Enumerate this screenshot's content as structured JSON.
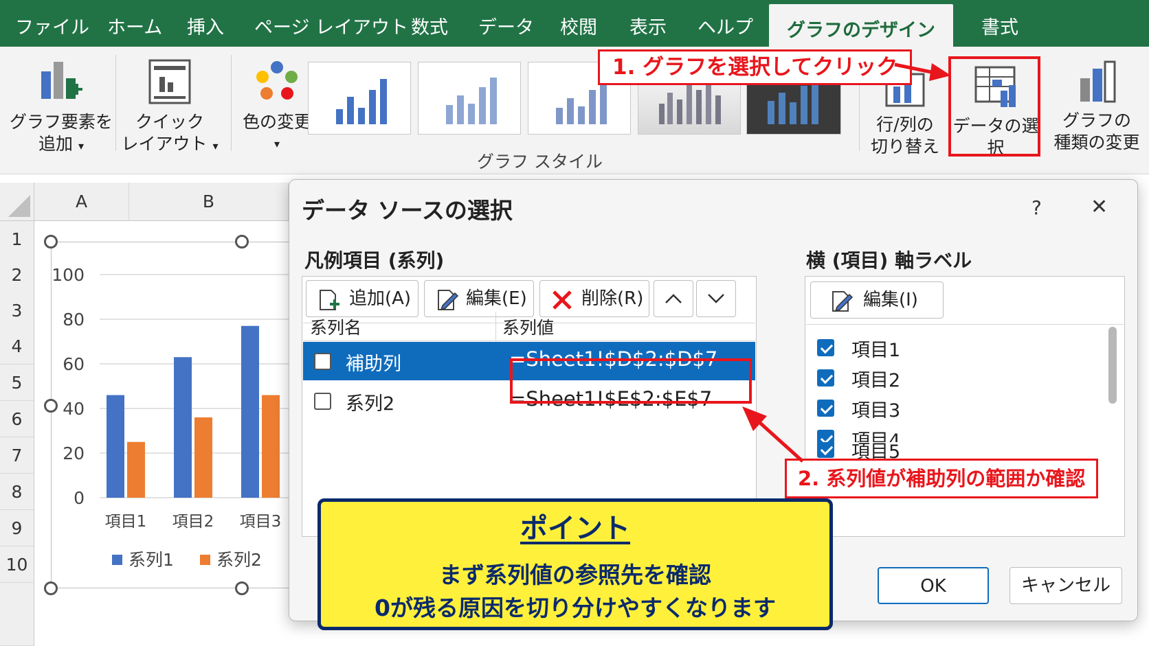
{
  "ribbon_tabs": [
    "ファイル",
    "ホーム",
    "挿入",
    "ページ レイアウト",
    "数式",
    "データ",
    "校閲",
    "表示",
    "ヘルプ",
    "グラフのデザイン",
    "書式"
  ],
  "ribbon": {
    "add_element_l1": "グラフ要素を",
    "add_element_l2": "追加",
    "quick_layout_l1": "クイック",
    "quick_layout_l2": "レイアウト",
    "change_color": "色の変更",
    "chart_styles": "グラフ スタイル",
    "switch_row_col_l1": "行/列の",
    "switch_row_col_l2": "切り替え",
    "select_data": "データの選択",
    "change_type_l1": "グラフの",
    "change_type_l2": "種類の変更"
  },
  "annotations": {
    "step1": "1. グラフを選択してクリック",
    "step2": "2. 系列値が補助列の範囲か確認",
    "point_title": "ポイント",
    "point_line1": "まず系列値の参照先を確認",
    "point_line2": "0が残る原因を切り分けやすくなります"
  },
  "sheet": {
    "columns": [
      "A",
      "B"
    ],
    "rows": [
      "1",
      "2",
      "3",
      "4",
      "5",
      "6",
      "7",
      "8",
      "9",
      "10"
    ]
  },
  "chart_data": {
    "type": "bar",
    "categories": [
      "項目1",
      "項目2",
      "項目3"
    ],
    "series": [
      {
        "name": "系列1",
        "values": [
          46,
          63,
          77
        ],
        "color": "#4472c4"
      },
      {
        "name": "系列2",
        "values": [
          25,
          36,
          46
        ],
        "color": "#ed7d31"
      }
    ],
    "ylim": [
      0,
      100
    ],
    "yticks": [
      "100",
      "80",
      "60",
      "40",
      "20",
      "0"
    ],
    "legend": "bottom",
    "grid": true
  },
  "dialog": {
    "title": "データ ソースの選択",
    "help": "?",
    "close": "✕",
    "legend_section": "凡例項目 (系列)",
    "add": "追加(A)",
    "edit": "編集(E)",
    "delete": "削除(R)",
    "up": "︿",
    "down": "﹀",
    "col_name": "系列名",
    "col_value": "系列値",
    "series_rows": [
      {
        "name": "補助列",
        "value": "=Sheet1!$D$2:$D$7"
      },
      {
        "name": "系列2",
        "value": "=Sheet1!$E$2:$E$7"
      }
    ],
    "axis_section": "横 (項目) 軸ラベル",
    "axis_edit": "編集(I)",
    "axis_items": [
      "項目1",
      "項目2",
      "項目3",
      "項目4",
      "項目5"
    ],
    "ok": "OK",
    "cancel": "キャンセル"
  },
  "colors": {
    "excel_green": "#217346",
    "selection_blue": "#0f6cbd",
    "annotation_red": "#e8161c",
    "point_yellow": "#fff03c",
    "point_navy": "#0b2a6b"
  }
}
